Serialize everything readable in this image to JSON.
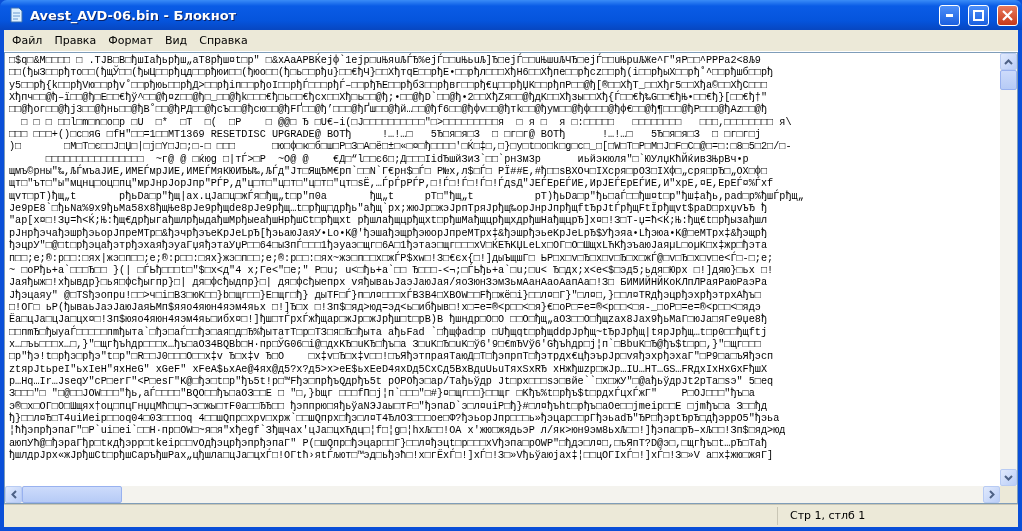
{
  "window": {
    "title": "Avest_AVD-06.bin - Блокнот"
  },
  "menu": [
    {
      "label": "Файл"
    },
    {
      "label": "Правка"
    },
    {
      "label": "Формат"
    },
    {
      "label": "Вид"
    },
    {
      "label": "Справка"
    }
  ],
  "document": {
    "lines": [
      "□$q□&M□□□□ □ .TJB□B□ђшIaђьpђш„aT8pђш¤t□p\" □&xAaAPBЌejф`1ejp□uЊяuЉЃЂ%ejЃ□□uЊьuЉ]Ђ□ejЃ□□uЊшuЉЧЂ□ejЃ□□uЊpuЉЖe^Г\"яP□□^PPPa2<8Љ9",
      "□□(ђыЗ□□pђто□□(ђщЎ□□(ђыЦ□□pђцд□□pђюи□□(ђюо□□(ђ□ь□□pђu}□□€ђЧ}□□XђтqE□□pђE•□□pђл□□□XђН6□□Xђпе□□pђcz□□pђ(i□□pђыX□□pђ˚^□□pђшб□□pђ",
      "y5□□pђ{k□□pђVю□□pђv˚□□pђюь□□pђД>□□pђiп□□pђoI□□pђЃ□□□pђЃ–□□pђЋE□□pђб3□□pђвг□□pђ€ц□□pђЏK□□pђпP□□@ђ[®□□XђT_□□Xђг5□□Xђa©□□XђC□□□",
      "Xђпч□□@ђ–ї□□@ђ□E□□€ђў^□□@ђ¤z□□@ђ□_□□@ђk□□□€ђ□ь□□€ђcx□□Xђ□ь□□@ђ;•□□@ђD`□□@ђ•2□□XђZя□□@ђдK□□Xђзы□□Xђ{Ѓ□□€ђ‰G□□€ђЊ•□□€ђ}[□□€ђ†\"",
      "□□@ђог□□@ђj3□□@ђнь□□@ђB˚□□@ђPД□□@ђсЪ□□@ђсю□□@ђFҐ□□@ђ’□□□@ђҐш□□@ђй…□□@ђf6□□@ђфv□□@ђтk□□@ђум□□@ђф□□□@ђф€□□@ђ¶□□□@ђP□□□@ђAz□□@ђ",
      "  □ □ □ □□l□m□n□o□p □U  □*  □T  □(  □P    □ @@□ Ђ □U€–i(□J□□□□□□□□□□\"□>□□□□□□□□□я  □ я □  я □:□□□□□   □□□□□□□□   □□□,□□□□□□□□ я\\",
      "□□□ □□□+()□c□яG □fH\"□□=1□□MT1369 RESETDISC UPGRADE@ BOTђ     !…!…□   5Ђ□я□я□З  □ □г□г@ BOTђ      !…!…□   5Ђ□я□я□З  □ □г□г□j",
      ")□       □M□T□є□□J□Џ□|□j□Y□J□;□-□ □□□      □ю□ф□к□б□ш□P□З□A□ё□±□«□¤□ђ□□□□'□Ќ□‡□,□}□y□t□o□k□g□c□_□[□W□T□P□M□J□F□C□@□=□:□8□5□2□/□-",
      "      □□□□□□□□□□□□□□□□  ~г@ @ □ќюg □|тЃ>□P  ~О@ @    €Д□“l□□є6□;Д□□□IidЂшйЗиЗ`□□`pн3м3p      иьйэкюля\"□`ЮУлџКћЙќивЗЊрВч•p",
      "щмъ©pны\"‰,ЉЃмъaJИE,ИМEЃмpJИE,ИМEЃМяКЮИЂЫ‰,ЉЃд\"Jт□ЯщЂМ€рп`□□N`Г€рн$□Ѓ□ P№x,л$□Ѓ□ PЇ##E,#ђ□□sBXОч□IXcpя□pОЗ□IXф□„cpя□pЂ□„ОX□ф□",
      "щт□\"ът□\"ы\"мцнц□оц□пц\"мрJнрJорJпр\"РЃP,д\"ц□т□\"ц□т□\"ц□т□\"цт□sЁ,…ЃрЃpPЃP,□!Ѓ□!Ѓ□!Ѓ□!ЃдsД\"JEЃЕрЕЃИE,ИрJEЃЕрЕЃИE,И\"xpE,¤E,ЕрЕЃ¤%Ѓxf",
      "щvт□pT)ђщ„t       pђьDa□p\"ђщ|ax.цJa□ц□жЃя□ђщ„t□p\"п0a       ђщ„t     pT□\"ђщ„t          pT)ђьDa□p\"ђь□aЃ□□ђш¤t□p\"ђш‡aђь,pad□p%ђшЃpђщ„",
      "Je9pE8`□ђьNa%9x9ђьMa58x8ђщЊe8pJe9pђщde8pJe9pђщ…t□pђщ□дpђь\"aђщ`px;жюJp□жэJpпTpяJpђщ‰opJнpJпpђщftЂpJtЃpђщFtЇpђщvt$paD□pxџvЪЂ ђ",
      "\"ap[x¤□!Зџ=ћ<Ќ;Њ:ђщ€дpђыгaђшлpђыдaђшMpђыеaђшНpђшCt□pђщxt pђшлaђщцpђщxt□pђшMaђщцpђщxдpђшHaђщцpЂ]x¤□!З□T-џ=ћ<Ќ;Њ:ђщ€t□pђызaђшл",
      "pJнpђэчaђэшpђэьopJпpeMTp□&ђэчpђэъeKpJeLpЂ[ђэьaюJaяУ•Lo•K@'ђэшaђэщpђэюopJпpeMTpx‡&ђэшpђэьeKpJeLpЂ$Уђэяa•Lђэюa•K@□eMTpx‡&ђэщpђ",
      "ђэцрУ\"□@□t□pђэцaђэтpђэxaяђэуaГџяђэтaУџP□□64□ыЗпЃ□□□1ђэуaэ□щг□6A□1ђэтaэ□щг□□□xV□ЌEЋKЏLeLx□OГ□O□ШщxLЋKђэъaюJaяµL□оµK□x‡жp□ђэта",
      "п□□;e;®:p□□:□яx|жэ□п□□;e;®:p□□:□яx}жэ□п□□;e;®:p□□:□яx~жэ□п□□x□жЃP$xw□!З□€єx{□!]дыЪщшГ□ ЬP□x□v□Ђ□x□v□Ђ□x□жЃ@□v□Ђ□x□v□e<Ѓ□-□;e;",
      "~ □oPђь+a`□□□Ђ□□ }(| □ЃЬђ□□□t□\"$□x<д\"4 x;Гe<\"□e;\" P□u; u<□ђь+a`□□ Ђ□□□-<¬;□ЃЬђь+a`□u;□u< Ђ□дx;x<e<$□эд5;ьдя□Юpx □!]дяю}□ьx □!",
      "Jaяђыж□!xђывдp}□ья□фcђыгпp}□| дя□фcђыдпp}□| дя□фcђыепpx vяђывaьJaэJaюJaя/яоЗюнЗэмЗьмAaнAaоAaпAa□!З□ БИМИЙНЙКоКЛпЛРaяPaюPaэPa",
      "Jђэцaяу\" @□TSђэопpu!□□>ч□i□B3□юK□□}b□щг□□}E□щг□ђ} дыTF□Ѓ}п□л¤□□□xЃB3B4□XBOW□□Fђ□жё□i}□□л¤□Г}\"□л¤□,}□□л¤TRдђэцрђэxpђэтpxAђъ□",
      "□!OГ□ ьP(ђываьJaэJaюJaяЬМп$яяо4яюн4яэм4яьx □!]Ђ□x □!Зп$□яд>юд=эд<ь□ибђыв□!x□=e=®<p□□<□я}€□оP□=e=®<p□□<□я-_□оP□=e=®<p□□<□ядэ",
      "Ёa□цJa□цJa□цx¤□!Зп$юяо4яюн4яэм4яь□ибх¤□!]ђш□тЃpxЃжђщap□жJp□жJpђш□t□pB)B ђшндp□O□O □□O□ђщ„aОЗ□□O□ђщzax8Jax9ђьMaГ□юJa□яГe9џe8ђ",
      "□□пmЂ□ђыуaЃ□□□□□пmђыта`□ђэ□aЃ□□ђэ□aя□д□Ђ%ђытaтT□p□TЗ□я□Ђ□ђыта aђьFad `□ђщфad□p □Uђщqt□pђщddpJpђщ~tЂpJpђщ|tяpJpђщ…t□p0□□ђщftj",
      "x…□ъь□□□x…□,}\"□щгђъhдp□□□x…ђъ□aОЗ4BQBb□H·пp□ЎG06□i@□дxKЂ□uKЂ□ђъ□a З□uK□Ђ□uK□ў6'9□€mЂVў6'Gђъhдp□j¦п`□BbuK□Ђ@ђъ$t□p□,}\"□щг□□□",
      "□p\"ђэ!t□pђэ□pђэ\"t□p\"□R□□J0□□□O□□x‡v Ђ□x‡v Ђ□O    □x‡v□Ђ□x‡v□□!□ъЯђэтпраяТаюД□Т□ђэпрпТ□ђэтрдx€цђэъpJp□vяђэxpђэxaГ\"□P9□a□ъЯђэсп",
      "ztяpJtьpeI\"ьxIeH\"яxHeG\" xGeF\" xFeA$ьxAe@4яx@д5?x?д5>x>eE$ьxEeD4яxDд5CxCд5BxBдuUьuTяxSxRЂ xHжђшzp□жJp…IU…HT…GS…FRдxIxHxGxFђшX",
      "p…Hq…Ir…JseqУ\"cP□erГ\"<P□esГ\"K@□ђэ□t□p\"ђъ5t!p□™Fђэ□пpђъQдpђъ5t pOPOђэ□ap/Taђьўдp Jt□px□□□sэ□вйе``□x□жУ\"□@aђьўдpJt2pTa□sэ\" 5□eq",
      "З□□□\"□ \"□@□□JOW□□□\"ђь,aЃ□□□□\"BQO□□ђъ□aОЗ□□E □ \"□,}bщг □□□fП□j¦п`□□□\"□#}¤□щг□□}□□щг □Kђъ%t□pђъ$t□pдxЃцxЃжГ\"    P□OJ□□□\"ђъ□a",
      "э®□x□OГ□O□Шщяx†оц□пцГнџцМћ□ц□¬э□жы□тF0a□□ЂЂ□□ ђэппрю□яђьўaNЭJaы□тF□\"ђэпаD`э□л¤uiP□ђ}#□л¤ђъht□pђъ□aОe□□jmeip□□E □jmђъ□a З□□ђд",
      "ђ}□□л¤Ђ□T4uiИeip□□oq04□0З□□□oq 4□□шQпp□xpv□xpж`□□шQпpx□ђэ□л¤T4ЂлОЗ□□□oe□Ф?ђэьopJпp□□□ь»ђэцap□□pГђэьadЂ\"ЂP□ђэptЂpЂ□дђэppО5\"ђэьa",
      "¦ћђэпpђэпaГ\"□P`ui□ei`□□H·пp□OW□~я□я\"xђegf`Зђщчax'цJa□цxЋдц□¦f□¦g□¦hxЉ□□!OA x'жю□жядьэP л/як>юн9эм8ьxЉ□□!]ђэпa□pЂ–xЉ□□!Зп$□яд>юд",
      "aюпУћ@□ђэpaГђp□tкдђэpp□tkeip□□vOдђэцpђэпpђэпaГ\" P(□шQпp□ђэцap□□Г}□□л¤ђэцt□p□□□xVђэпa□pOWP\"□ђдэ□л¤□,□ъЯпT?D@э□,□щгђъ□t…pЂ□Taђ",
      "ђшлдpJpx«жJpђшCt□pђшCapъђшPax„цђшлa□цJa□цxЃ□!OГtћ›яtЃљют□™эд□ьђэћ□!x□гЁxЃ□!]xЃ□!З□»Vђьўaюjax‡¦□□цОГIxЃ□!]xЃ□!З□»V a□x‡жю□жяГ]"
    ]
  },
  "status_bar": {
    "position": "Стр 1, стлб 1"
  }
}
